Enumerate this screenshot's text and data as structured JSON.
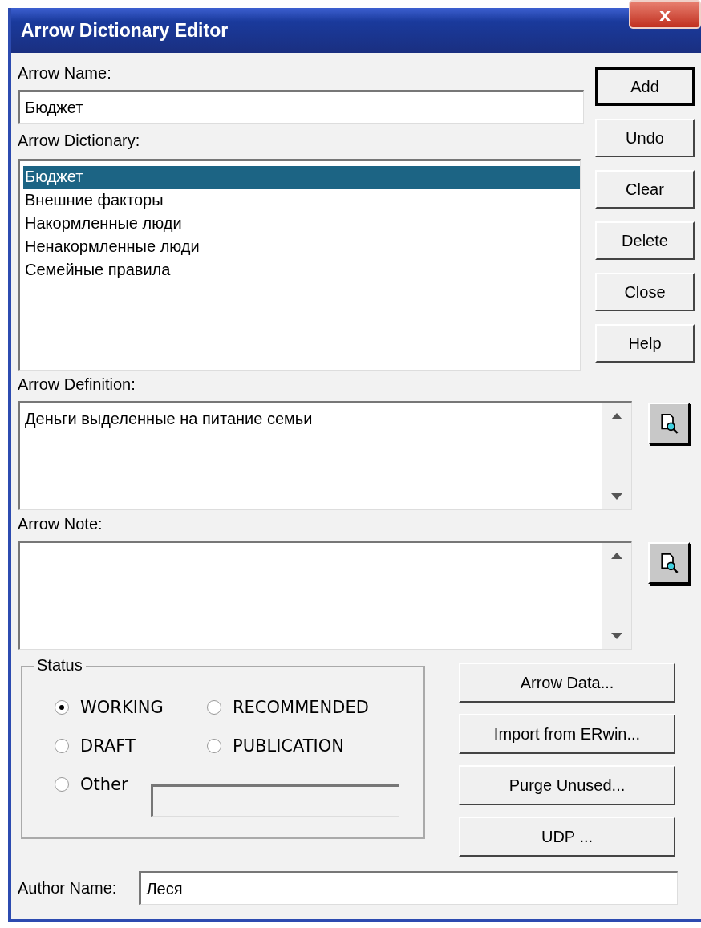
{
  "window": {
    "title": "Arrow Dictionary Editor",
    "close": "x"
  },
  "arrow_name": {
    "label": "Arrow Name:",
    "value": "Бюджет"
  },
  "dictionary": {
    "label": "Arrow Dictionary:",
    "items": [
      {
        "text": "Бюджет",
        "selected": true
      },
      {
        "text": "Внешние факторы",
        "selected": false
      },
      {
        "text": "Накормленные люди",
        "selected": false
      },
      {
        "text": "Ненакормленные люди",
        "selected": false
      },
      {
        "text": "Семейные правила",
        "selected": false
      }
    ]
  },
  "side_buttons": [
    {
      "label": "Add",
      "default": true
    },
    {
      "label": "Undo",
      "default": false
    },
    {
      "label": "Clear",
      "default": false
    },
    {
      "label": "Delete",
      "default": false
    },
    {
      "label": "Close",
      "default": false
    },
    {
      "label": "Help",
      "default": false
    }
  ],
  "definition": {
    "label": "Arrow Definition:",
    "value": "Деньги выделенные на питание семьи"
  },
  "note": {
    "label": "Arrow Note:"
  },
  "status": {
    "label": "Status",
    "options": [
      {
        "label": "WORKING",
        "selected": true,
        "kind": "radio"
      },
      {
        "label": "RECOMMENDED",
        "selected": false,
        "kind": "radio"
      },
      {
        "label": "DRAFT",
        "selected": false,
        "kind": "radio"
      },
      {
        "label": "PUBLICATION",
        "selected": false,
        "kind": "radio"
      },
      {
        "label": "Other",
        "selected": false,
        "kind": "radio_field"
      }
    ]
  },
  "action_buttons": [
    "Arrow Data...",
    "Import from ERwin...",
    "Purge Unused...",
    "UDP ..."
  ],
  "author": {
    "label": "Author Name:",
    "value": "Леся"
  }
}
